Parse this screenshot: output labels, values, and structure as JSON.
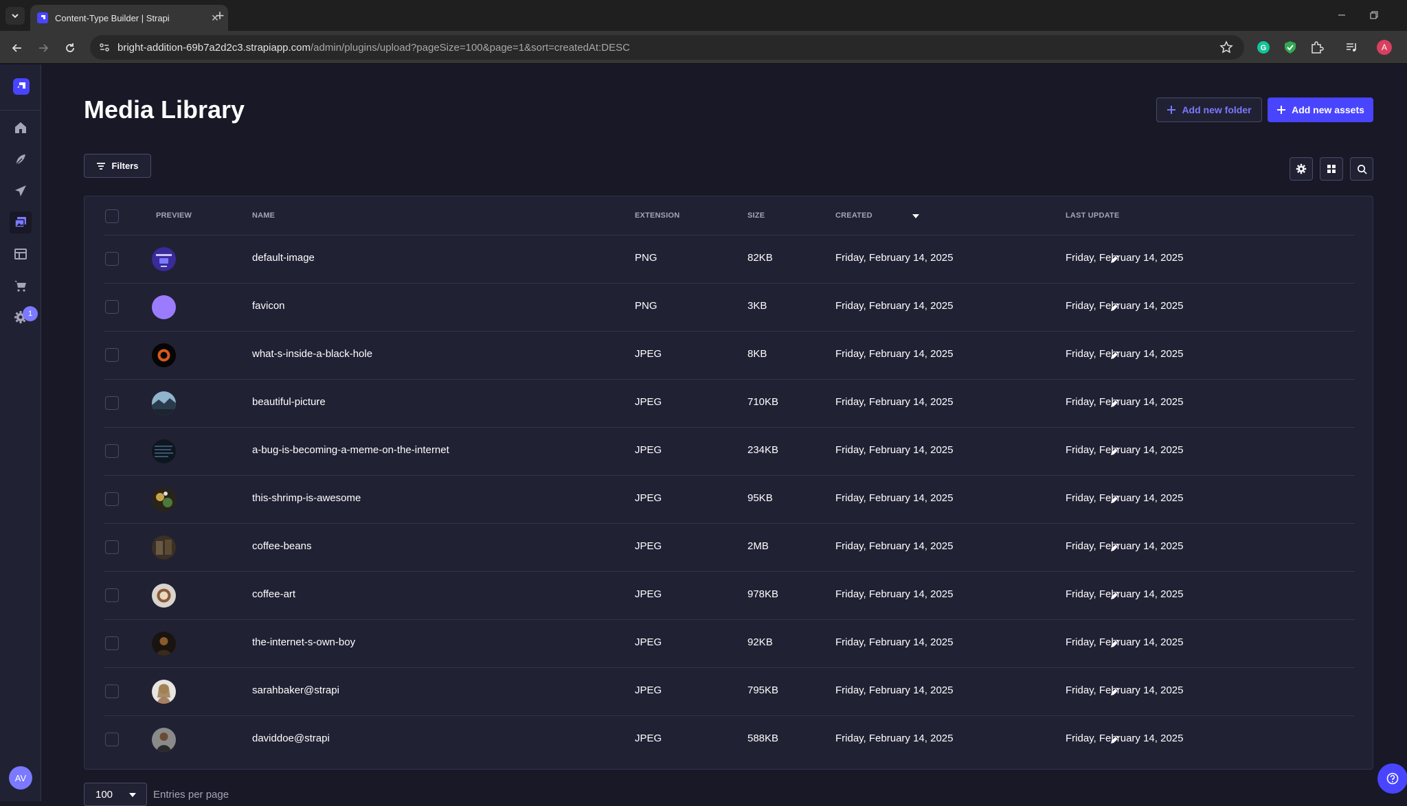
{
  "browser": {
    "tab_title": "Content-Type Builder | Strapi",
    "url_host": "bright-addition-69b7a2d2c3.strapiapp.com",
    "url_path": "/admin/plugins/upload?pageSize=100&page=1&sort=createdAt:DESC",
    "profile_initial": "A"
  },
  "sidebar": {
    "badge_count": "1",
    "user_initials": "AV"
  },
  "header": {
    "title": "Media Library",
    "add_folder_label": "Add new folder",
    "add_assets_label": "Add new assets"
  },
  "toolbar": {
    "filters_label": "Filters"
  },
  "table": {
    "columns": {
      "preview": "PREVIEW",
      "name": "NAME",
      "extension": "EXTENSION",
      "size": "SIZE",
      "created": "CREATED",
      "last_update": "LAST UPDATE"
    },
    "rows": [
      {
        "name": "default-image",
        "ext": "PNG",
        "size": "82KB",
        "created": "Friday, February 14, 2025",
        "updated": "Friday, February 14, 2025"
      },
      {
        "name": "favicon",
        "ext": "PNG",
        "size": "3KB",
        "created": "Friday, February 14, 2025",
        "updated": "Friday, February 14, 2025"
      },
      {
        "name": "what-s-inside-a-black-hole",
        "ext": "JPEG",
        "size": "8KB",
        "created": "Friday, February 14, 2025",
        "updated": "Friday, February 14, 2025"
      },
      {
        "name": "beautiful-picture",
        "ext": "JPEG",
        "size": "710KB",
        "created": "Friday, February 14, 2025",
        "updated": "Friday, February 14, 2025"
      },
      {
        "name": "a-bug-is-becoming-a-meme-on-the-internet",
        "ext": "JPEG",
        "size": "234KB",
        "created": "Friday, February 14, 2025",
        "updated": "Friday, February 14, 2025"
      },
      {
        "name": "this-shrimp-is-awesome",
        "ext": "JPEG",
        "size": "95KB",
        "created": "Friday, February 14, 2025",
        "updated": "Friday, February 14, 2025"
      },
      {
        "name": "coffee-beans",
        "ext": "JPEG",
        "size": "2MB",
        "created": "Friday, February 14, 2025",
        "updated": "Friday, February 14, 2025"
      },
      {
        "name": "coffee-art",
        "ext": "JPEG",
        "size": "978KB",
        "created": "Friday, February 14, 2025",
        "updated": "Friday, February 14, 2025"
      },
      {
        "name": "the-internet-s-own-boy",
        "ext": "JPEG",
        "size": "92KB",
        "created": "Friday, February 14, 2025",
        "updated": "Friday, February 14, 2025"
      },
      {
        "name": "sarahbaker@strapi",
        "ext": "JPEG",
        "size": "795KB",
        "created": "Friday, February 14, 2025",
        "updated": "Friday, February 14, 2025"
      },
      {
        "name": "daviddoe@strapi",
        "ext": "JPEG",
        "size": "588KB",
        "created": "Friday, February 14, 2025",
        "updated": "Friday, February 14, 2025"
      }
    ]
  },
  "footer": {
    "page_size": "100",
    "entries_label": "Entries per page"
  },
  "colors": {
    "accent": "#4945ff",
    "accent_light": "#7b79ff",
    "background": "#181826",
    "surface": "#212134",
    "border": "#32324d"
  }
}
